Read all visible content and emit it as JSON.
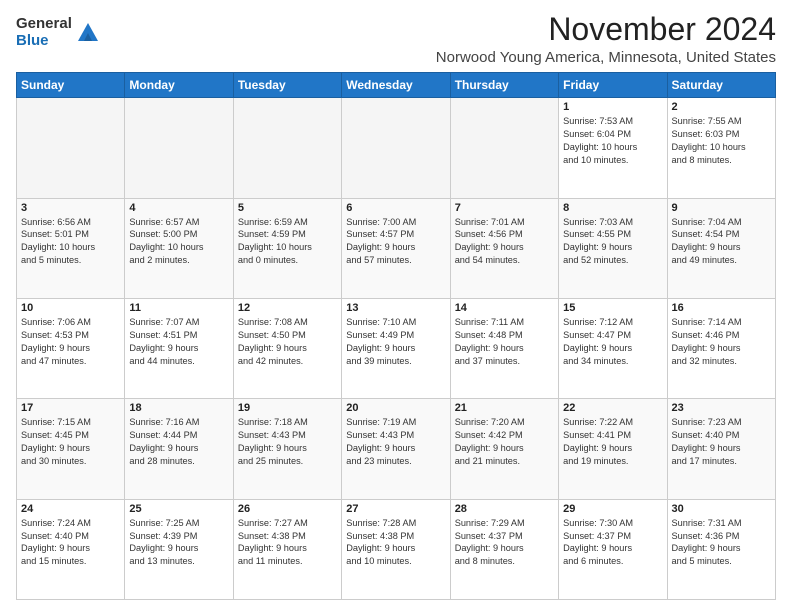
{
  "logo": {
    "general": "General",
    "blue": "Blue"
  },
  "title": "November 2024",
  "location": "Norwood Young America, Minnesota, United States",
  "days_header": [
    "Sunday",
    "Monday",
    "Tuesday",
    "Wednesday",
    "Thursday",
    "Friday",
    "Saturday"
  ],
  "weeks": [
    [
      {
        "day": "",
        "info": ""
      },
      {
        "day": "",
        "info": ""
      },
      {
        "day": "",
        "info": ""
      },
      {
        "day": "",
        "info": ""
      },
      {
        "day": "",
        "info": ""
      },
      {
        "day": "1",
        "info": "Sunrise: 7:53 AM\nSunset: 6:04 PM\nDaylight: 10 hours\nand 10 minutes."
      },
      {
        "day": "2",
        "info": "Sunrise: 7:55 AM\nSunset: 6:03 PM\nDaylight: 10 hours\nand 8 minutes."
      }
    ],
    [
      {
        "day": "3",
        "info": "Sunrise: 6:56 AM\nSunset: 5:01 PM\nDaylight: 10 hours\nand 5 minutes."
      },
      {
        "day": "4",
        "info": "Sunrise: 6:57 AM\nSunset: 5:00 PM\nDaylight: 10 hours\nand 2 minutes."
      },
      {
        "day": "5",
        "info": "Sunrise: 6:59 AM\nSunset: 4:59 PM\nDaylight: 10 hours\nand 0 minutes."
      },
      {
        "day": "6",
        "info": "Sunrise: 7:00 AM\nSunset: 4:57 PM\nDaylight: 9 hours\nand 57 minutes."
      },
      {
        "day": "7",
        "info": "Sunrise: 7:01 AM\nSunset: 4:56 PM\nDaylight: 9 hours\nand 54 minutes."
      },
      {
        "day": "8",
        "info": "Sunrise: 7:03 AM\nSunset: 4:55 PM\nDaylight: 9 hours\nand 52 minutes."
      },
      {
        "day": "9",
        "info": "Sunrise: 7:04 AM\nSunset: 4:54 PM\nDaylight: 9 hours\nand 49 minutes."
      }
    ],
    [
      {
        "day": "10",
        "info": "Sunrise: 7:06 AM\nSunset: 4:53 PM\nDaylight: 9 hours\nand 47 minutes."
      },
      {
        "day": "11",
        "info": "Sunrise: 7:07 AM\nSunset: 4:51 PM\nDaylight: 9 hours\nand 44 minutes."
      },
      {
        "day": "12",
        "info": "Sunrise: 7:08 AM\nSunset: 4:50 PM\nDaylight: 9 hours\nand 42 minutes."
      },
      {
        "day": "13",
        "info": "Sunrise: 7:10 AM\nSunset: 4:49 PM\nDaylight: 9 hours\nand 39 minutes."
      },
      {
        "day": "14",
        "info": "Sunrise: 7:11 AM\nSunset: 4:48 PM\nDaylight: 9 hours\nand 37 minutes."
      },
      {
        "day": "15",
        "info": "Sunrise: 7:12 AM\nSunset: 4:47 PM\nDaylight: 9 hours\nand 34 minutes."
      },
      {
        "day": "16",
        "info": "Sunrise: 7:14 AM\nSunset: 4:46 PM\nDaylight: 9 hours\nand 32 minutes."
      }
    ],
    [
      {
        "day": "17",
        "info": "Sunrise: 7:15 AM\nSunset: 4:45 PM\nDaylight: 9 hours\nand 30 minutes."
      },
      {
        "day": "18",
        "info": "Sunrise: 7:16 AM\nSunset: 4:44 PM\nDaylight: 9 hours\nand 28 minutes."
      },
      {
        "day": "19",
        "info": "Sunrise: 7:18 AM\nSunset: 4:43 PM\nDaylight: 9 hours\nand 25 minutes."
      },
      {
        "day": "20",
        "info": "Sunrise: 7:19 AM\nSunset: 4:43 PM\nDaylight: 9 hours\nand 23 minutes."
      },
      {
        "day": "21",
        "info": "Sunrise: 7:20 AM\nSunset: 4:42 PM\nDaylight: 9 hours\nand 21 minutes."
      },
      {
        "day": "22",
        "info": "Sunrise: 7:22 AM\nSunset: 4:41 PM\nDaylight: 9 hours\nand 19 minutes."
      },
      {
        "day": "23",
        "info": "Sunrise: 7:23 AM\nSunset: 4:40 PM\nDaylight: 9 hours\nand 17 minutes."
      }
    ],
    [
      {
        "day": "24",
        "info": "Sunrise: 7:24 AM\nSunset: 4:40 PM\nDaylight: 9 hours\nand 15 minutes."
      },
      {
        "day": "25",
        "info": "Sunrise: 7:25 AM\nSunset: 4:39 PM\nDaylight: 9 hours\nand 13 minutes."
      },
      {
        "day": "26",
        "info": "Sunrise: 7:27 AM\nSunset: 4:38 PM\nDaylight: 9 hours\nand 11 minutes."
      },
      {
        "day": "27",
        "info": "Sunrise: 7:28 AM\nSunset: 4:38 PM\nDaylight: 9 hours\nand 10 minutes."
      },
      {
        "day": "28",
        "info": "Sunrise: 7:29 AM\nSunset: 4:37 PM\nDaylight: 9 hours\nand 8 minutes."
      },
      {
        "day": "29",
        "info": "Sunrise: 7:30 AM\nSunset: 4:37 PM\nDaylight: 9 hours\nand 6 minutes."
      },
      {
        "day": "30",
        "info": "Sunrise: 7:31 AM\nSunset: 4:36 PM\nDaylight: 9 hours\nand 5 minutes."
      }
    ]
  ]
}
